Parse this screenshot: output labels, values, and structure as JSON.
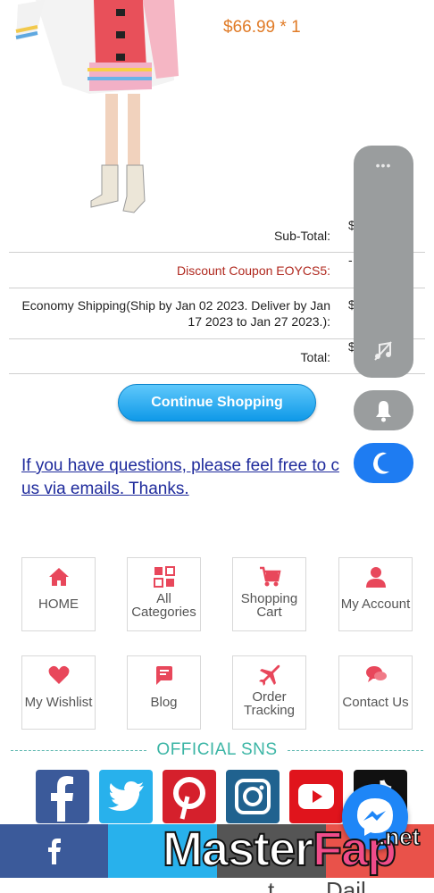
{
  "product": {
    "price": "$66.99 * 1"
  },
  "totals": {
    "subtotal_label": "Sub-Total:",
    "subtotal_value": "$",
    "discount_label": "Discount Coupon EOYCS5:",
    "discount_value": "-",
    "shipping_label": "Economy Shipping(Ship by Jan 02 2023. Deliver by Jan 17 2023 to Jan 27 2023.):",
    "shipping_value": "$",
    "total_label": "Total:",
    "total_value": "$"
  },
  "continue_button": "Continue Shopping",
  "questions_link": "If you have questions, please feel free to c",
  "questions_link_2": "us via emails. Thanks.",
  "nav": {
    "home": "HOME",
    "all_categories_1": "All",
    "all_categories_2": "Categories",
    "shopping_cart_1": "Shopping",
    "shopping_cart_2": "Cart",
    "my_account": "My Account",
    "my_wishlist": "My Wishlist",
    "blog": "Blog",
    "order_tracking_1": "Order",
    "order_tracking_2": "Tracking",
    "contact_us": "Contact Us"
  },
  "sns_title": "OFFICIAL SNS",
  "float_menu": {
    "dots": "•••"
  },
  "watermark": {
    "master": "Master",
    "fap": "Fap",
    "net": ".net"
  },
  "bottom_partial_text": "t... ... Dail",
  "colors": {
    "accent_orange": "#e07b27",
    "discount_red": "#b0281e",
    "nav_icon_red": "#e8475b",
    "sns_teal": "#3bb5a5",
    "button_blue": "#1a9fea"
  }
}
